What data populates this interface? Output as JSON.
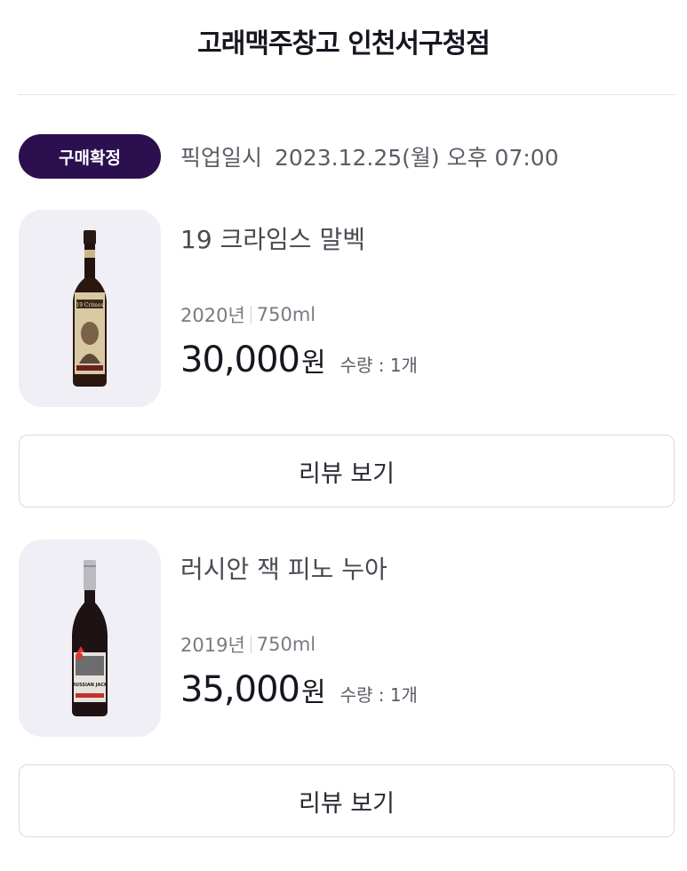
{
  "header": {
    "title": "고래맥주창고 인천서구청점"
  },
  "order": {
    "status": "구매확정",
    "pickup_label": "픽업일시",
    "pickup_datetime": "2023.12.25(월) 오후 07:00"
  },
  "items": [
    {
      "name": "19 크라임스 말벡",
      "vintage": "2020년",
      "volume": "750ml",
      "price": "30,000",
      "currency": "원",
      "quantity": "수량 : 1개",
      "label_text": "19 Crimes",
      "bottle_icon": "wine-bottle-icon",
      "review_label": "리뷰 보기"
    },
    {
      "name": "러시안 잭 피노 누아",
      "vintage": "2019년",
      "volume": "750ml",
      "price": "35,000",
      "currency": "원",
      "quantity": "수량 : 1개",
      "label_text": "RUSSIAN JACK",
      "bottle_icon": "wine-bottle-icon",
      "review_label": "리뷰 보기"
    }
  ]
}
